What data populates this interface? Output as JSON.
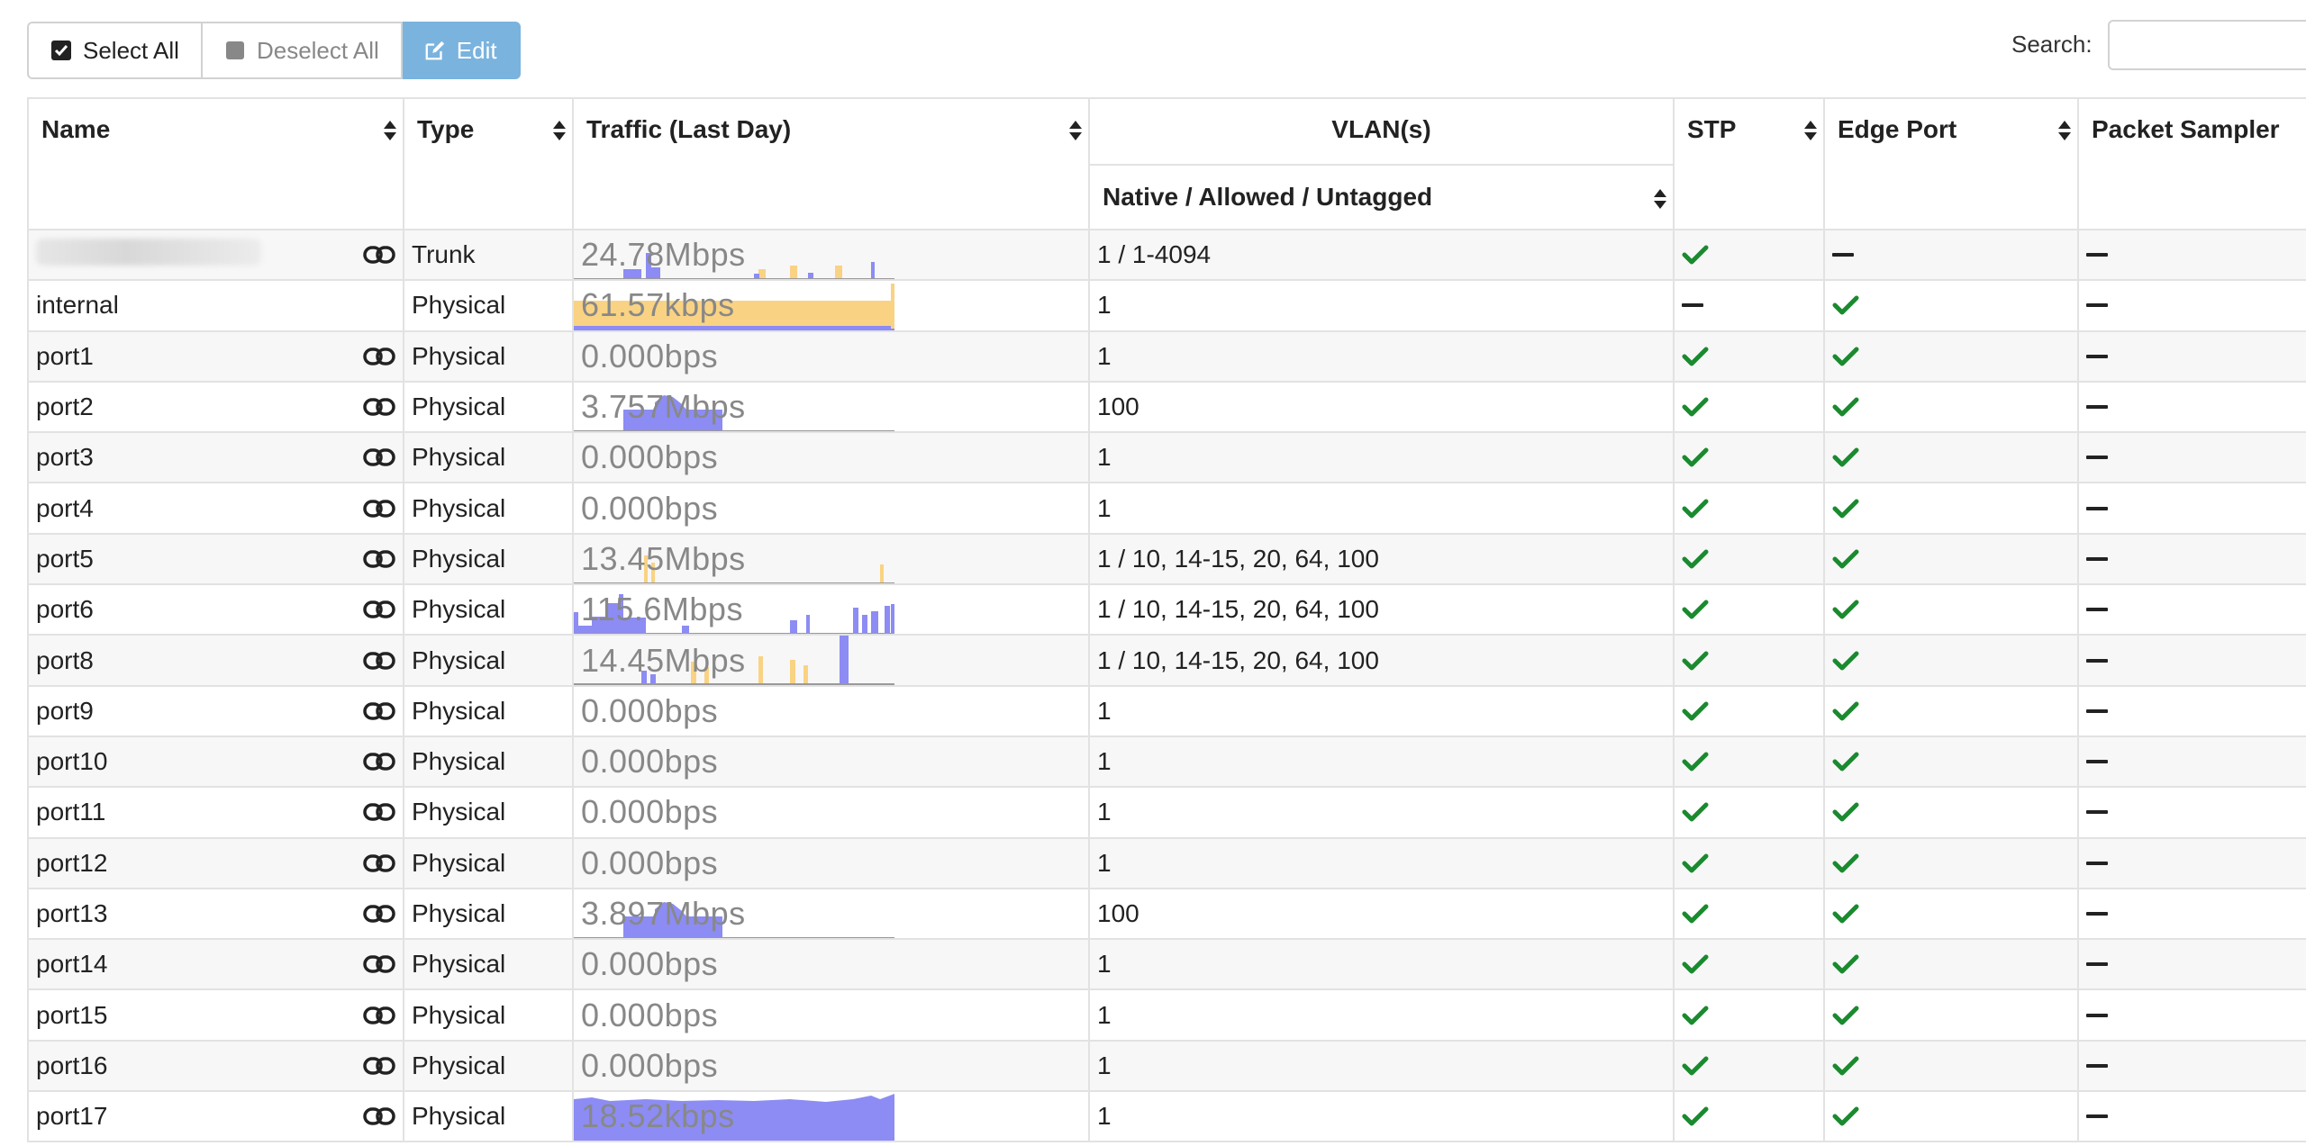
{
  "toolbar": {
    "select_all": "Select All",
    "deselect_all": "Deselect All",
    "edit": "Edit"
  },
  "search": {
    "label": "Search:",
    "value": ""
  },
  "columns": {
    "name": "Name",
    "type": "Type",
    "traffic": "Traffic (Last Day)",
    "vlans": "VLAN(s)",
    "vlans_sub": "Native / Allowed / Untagged",
    "stp": "STP",
    "edge_port": "Edge Port",
    "packet_sampler": "Packet Sampler"
  },
  "colors": {
    "rx": "#8c8cf4",
    "tx": "#f9d383",
    "check": "#1a8a2e",
    "edit_button": "#7ab3de"
  },
  "rows": [
    {
      "name": "",
      "redacted": true,
      "link": true,
      "type": "Trunk",
      "traffic": "24.78Mbps",
      "vlan": "1 / 1-4094",
      "stp": true,
      "edge": false,
      "sampler": false,
      "spark": "trunk"
    },
    {
      "name": "internal",
      "link": false,
      "type": "Physical",
      "traffic": "61.57kbps",
      "vlan": "1",
      "stp": false,
      "edge": true,
      "sampler": false,
      "spark": "internal"
    },
    {
      "name": "port1",
      "link": true,
      "type": "Physical",
      "traffic": "0.000bps",
      "vlan": "1",
      "stp": true,
      "edge": true,
      "sampler": false,
      "spark": "none"
    },
    {
      "name": "port2",
      "link": true,
      "type": "Physical",
      "traffic": "3.757Mbps",
      "vlan": "100",
      "stp": true,
      "edge": true,
      "sampler": false,
      "spark": "block"
    },
    {
      "name": "port3",
      "link": true,
      "type": "Physical",
      "traffic": "0.000bps",
      "vlan": "1",
      "stp": true,
      "edge": true,
      "sampler": false,
      "spark": "none"
    },
    {
      "name": "port4",
      "link": true,
      "type": "Physical",
      "traffic": "0.000bps",
      "vlan": "1",
      "stp": true,
      "edge": true,
      "sampler": false,
      "spark": "none"
    },
    {
      "name": "port5",
      "link": true,
      "type": "Physical",
      "traffic": "13.45Mbps",
      "vlan": "1 / 10, 14-15, 20, 64, 100",
      "stp": true,
      "edge": true,
      "sampler": false,
      "spark": "port5"
    },
    {
      "name": "port6",
      "link": true,
      "type": "Physical",
      "traffic": "115.6Mbps",
      "vlan": "1 / 10, 14-15, 20, 64, 100",
      "stp": true,
      "edge": true,
      "sampler": false,
      "spark": "port6"
    },
    {
      "name": "port8",
      "link": true,
      "type": "Physical",
      "traffic": "14.45Mbps",
      "vlan": "1 / 10, 14-15, 20, 64, 100",
      "stp": true,
      "edge": true,
      "sampler": false,
      "spark": "port8"
    },
    {
      "name": "port9",
      "link": true,
      "type": "Physical",
      "traffic": "0.000bps",
      "vlan": "1",
      "stp": true,
      "edge": true,
      "sampler": false,
      "spark": "none"
    },
    {
      "name": "port10",
      "link": true,
      "type": "Physical",
      "traffic": "0.000bps",
      "vlan": "1",
      "stp": true,
      "edge": true,
      "sampler": false,
      "spark": "none"
    },
    {
      "name": "port11",
      "link": true,
      "type": "Physical",
      "traffic": "0.000bps",
      "vlan": "1",
      "stp": true,
      "edge": true,
      "sampler": false,
      "spark": "none"
    },
    {
      "name": "port12",
      "link": true,
      "type": "Physical",
      "traffic": "0.000bps",
      "vlan": "1",
      "stp": true,
      "edge": true,
      "sampler": false,
      "spark": "none"
    },
    {
      "name": "port13",
      "link": true,
      "type": "Physical",
      "traffic": "3.897Mbps",
      "vlan": "100",
      "stp": true,
      "edge": true,
      "sampler": false,
      "spark": "block"
    },
    {
      "name": "port14",
      "link": true,
      "type": "Physical",
      "traffic": "0.000bps",
      "vlan": "1",
      "stp": true,
      "edge": true,
      "sampler": false,
      "spark": "none"
    },
    {
      "name": "port15",
      "link": true,
      "type": "Physical",
      "traffic": "0.000bps",
      "vlan": "1",
      "stp": true,
      "edge": true,
      "sampler": false,
      "spark": "none"
    },
    {
      "name": "port16",
      "link": true,
      "type": "Physical",
      "traffic": "0.000bps",
      "vlan": "1",
      "stp": true,
      "edge": true,
      "sampler": false,
      "spark": "none"
    },
    {
      "name": "port17",
      "link": true,
      "type": "Physical",
      "traffic": "18.52kbps",
      "vlan": "1",
      "stp": true,
      "edge": true,
      "sampler": false,
      "spark": "full"
    }
  ]
}
